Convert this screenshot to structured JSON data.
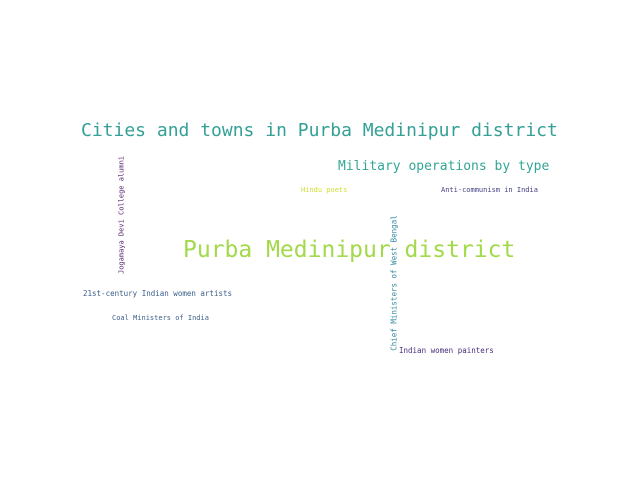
{
  "word_cloud": {
    "words": [
      {
        "text": "Cities and towns in Purba Medinipur district",
        "color": "#34a096"
      },
      {
        "text": "Military operations by type",
        "color": "#34a696"
      },
      {
        "text": "Hindu poets",
        "color": "#d2df2e"
      },
      {
        "text": "Anti-communism in India",
        "color": "#433f83"
      },
      {
        "text": "Purba Medinipur district",
        "color": "#a3d94a"
      },
      {
        "text": "21st-century Indian women artists",
        "color": "#3a5e8b"
      },
      {
        "text": "Coal Ministers of India",
        "color": "#3f5f8c"
      },
      {
        "text": "Indian women painters",
        "color": "#482d7a"
      },
      {
        "text": "Jogamaya Devi College alumni",
        "color": "#58246e"
      },
      {
        "text": "Chief Ministers of West Bengal",
        "color": "#3388a0"
      }
    ]
  }
}
